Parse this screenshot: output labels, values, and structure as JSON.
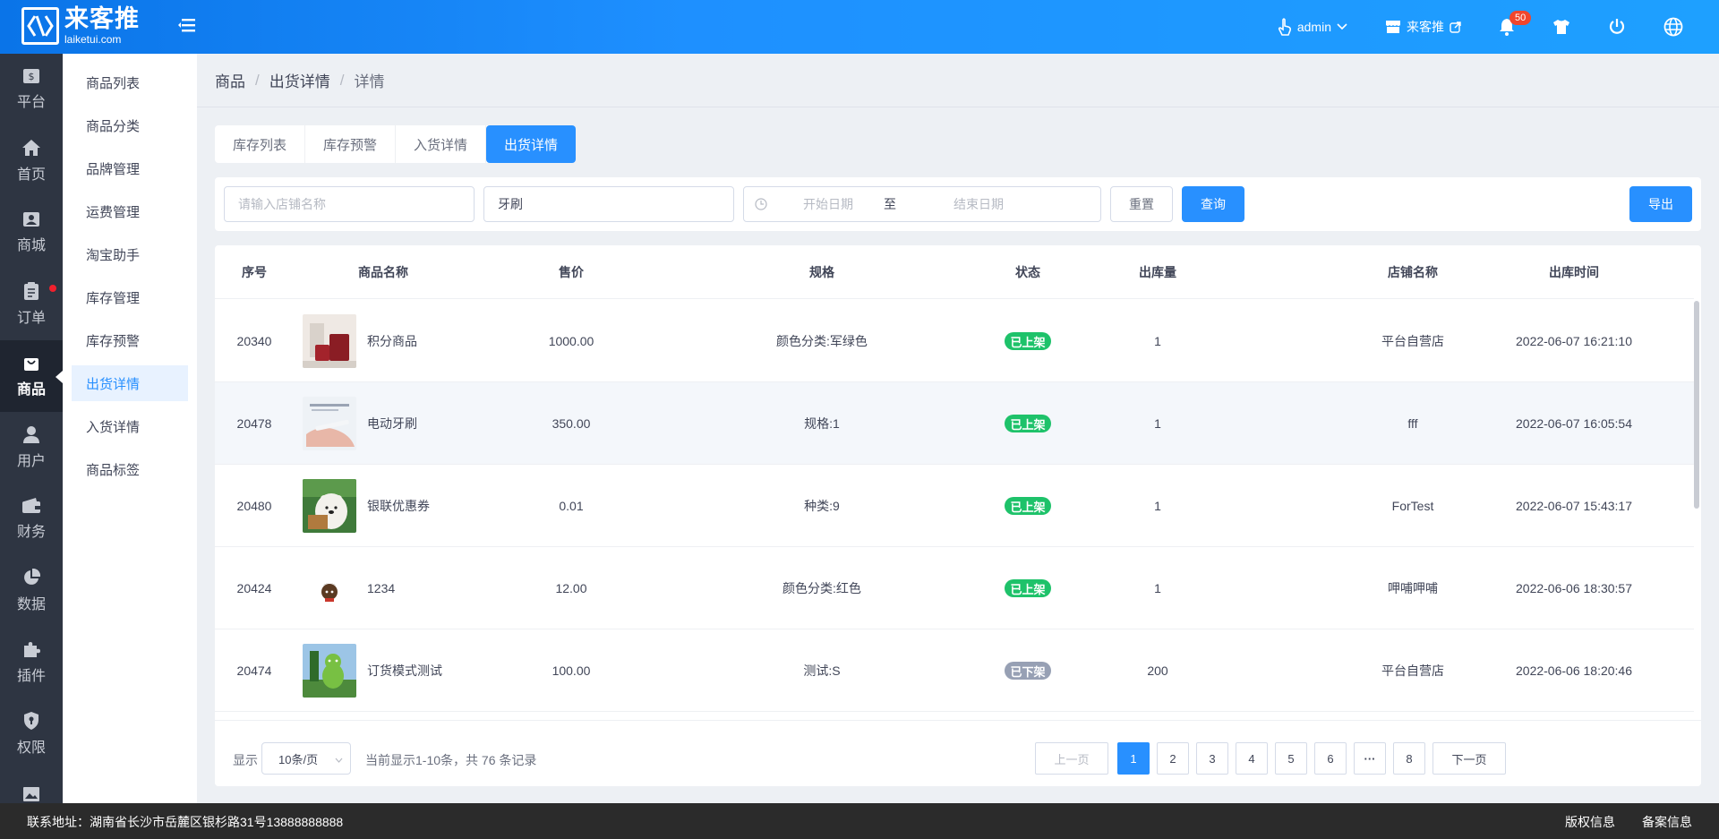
{
  "header": {
    "logo_cn": "来客推",
    "logo_en": "laiketui.com",
    "user": "admin",
    "store": "来客推",
    "notification_count": "50"
  },
  "nav": [
    {
      "label": "平台",
      "icon": "dollar-icon"
    },
    {
      "label": "首页",
      "icon": "home-icon"
    },
    {
      "label": "商城",
      "icon": "mall-icon"
    },
    {
      "label": "订单",
      "icon": "order-icon"
    },
    {
      "label": "商品",
      "icon": "bag-icon"
    },
    {
      "label": "用户",
      "icon": "user-icon"
    },
    {
      "label": "财务",
      "icon": "wallet-icon"
    },
    {
      "label": "数据",
      "icon": "pie-chart-icon"
    },
    {
      "label": "插件",
      "icon": "puzzle-icon"
    },
    {
      "label": "权限",
      "icon": "shield-icon"
    }
  ],
  "submenu": [
    "商品列表",
    "商品分类",
    "品牌管理",
    "运费管理",
    "淘宝助手",
    "库存管理",
    "库存预警",
    "出货详情",
    "入货详情",
    "商品标签"
  ],
  "breadcrumb": [
    "商品",
    "出货详情",
    "详情"
  ],
  "tabs": [
    "库存列表",
    "库存预警",
    "入货详情",
    "出货详情"
  ],
  "filter": {
    "store_placeholder": "请输入店铺名称",
    "keyword_value": "牙刷",
    "start_placeholder": "开始日期",
    "to": "至",
    "end_placeholder": "结束日期",
    "reset": "重置",
    "query": "查询",
    "export": "导出"
  },
  "table": {
    "columns": [
      "序号",
      "商品名称",
      "售价",
      "规格",
      "状态",
      "出库量",
      "店铺名称",
      "出库时间"
    ],
    "rows": [
      {
        "id": "20340",
        "name": "积分商品",
        "price": "1000.00",
        "spec": "颜色分类:军绿色",
        "status": "已上架",
        "qty": "1",
        "store": "平台自营店",
        "time": "2022-06-07 16:21:10"
      },
      {
        "id": "20478",
        "name": "电动牙刷",
        "price": "350.00",
        "spec": "规格:1",
        "status": "已上架",
        "qty": "1",
        "store": "fff",
        "time": "2022-06-07 16:05:54"
      },
      {
        "id": "20480",
        "name": "银联优惠券",
        "price": "0.01",
        "spec": "种类:9",
        "status": "已上架",
        "qty": "1",
        "store": "ForTest",
        "time": "2022-06-07 15:43:17"
      },
      {
        "id": "20424",
        "name": "1234",
        "price": "12.00",
        "spec": "颜色分类:红色",
        "status": "已上架",
        "qty": "1",
        "store": "呷哺呷哺",
        "time": "2022-06-06 18:30:57"
      },
      {
        "id": "20474",
        "name": "订货模式测试",
        "price": "100.00",
        "spec": "测试:S",
        "status": "已下架",
        "qty": "200",
        "store": "平台自营店",
        "time": "2022-06-06 18:20:46"
      }
    ]
  },
  "pagination": {
    "show": "显示",
    "page_size": "10条/页",
    "summary": "当前显示1-10条，共 76 条记录",
    "prev": "上一页",
    "pages": [
      "1",
      "2",
      "3",
      "4",
      "5",
      "6",
      "···",
      "8"
    ],
    "next": "下一页"
  },
  "footer": {
    "address": "联系地址：湖南省长沙市岳麓区银杉路31号13888888888",
    "copyright": "版权信息",
    "icp": "备案信息"
  },
  "colors": {
    "primary": "#2890ff",
    "status_on": "#1ec26a",
    "status_off": "#97a0b4",
    "sidebar": "#2e3542"
  }
}
